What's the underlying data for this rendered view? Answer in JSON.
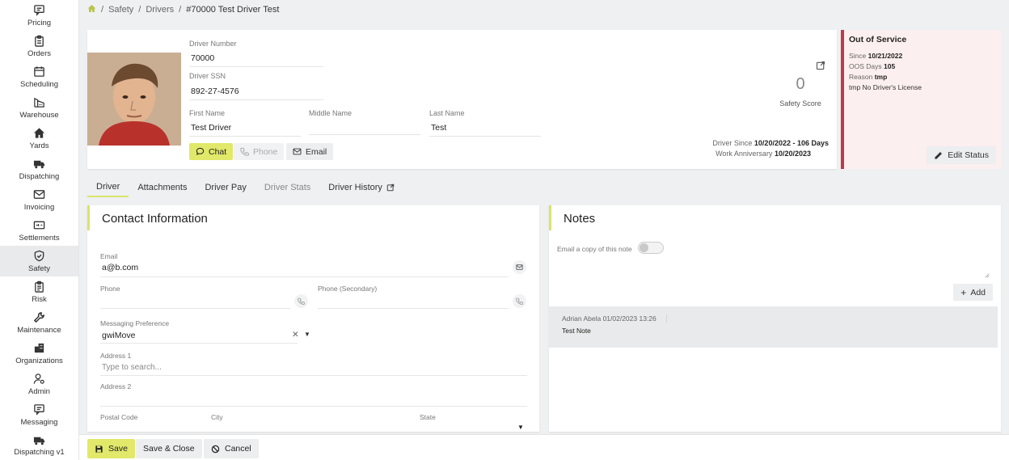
{
  "sidebar": {
    "items": [
      {
        "label": "Pricing",
        "icon": "chat-icon"
      },
      {
        "label": "Orders",
        "icon": "clipboard-icon"
      },
      {
        "label": "Scheduling",
        "icon": "calendar-icon"
      },
      {
        "label": "Warehouse",
        "icon": "warehouse-icon"
      },
      {
        "label": "Yards",
        "icon": "home-icon"
      },
      {
        "label": "Dispatching",
        "icon": "truck-icon"
      },
      {
        "label": "Invoicing",
        "icon": "envelope-icon"
      },
      {
        "label": "Settlements",
        "icon": "money-icon"
      },
      {
        "label": "Safety",
        "icon": "shield-icon",
        "active": true
      },
      {
        "label": "Risk",
        "icon": "clipboard-list-icon"
      },
      {
        "label": "Maintenance",
        "icon": "wrench-icon"
      },
      {
        "label": "Organizations",
        "icon": "buildings-icon"
      },
      {
        "label": "Admin",
        "icon": "user-gear-icon"
      },
      {
        "label": "Messaging",
        "icon": "message-icon"
      },
      {
        "label": "Dispatching v1",
        "icon": "truck-icon"
      }
    ]
  },
  "breadcrumb": {
    "items": [
      "Safety",
      "Drivers"
    ],
    "current": "#70000 Test Driver Test"
  },
  "driver": {
    "number_label": "Driver Number",
    "number": "70000",
    "ssn_label": "Driver SSN",
    "ssn": "892-27-4576",
    "first_name_label": "First Name",
    "first_name": "Test Driver",
    "middle_name_label": "Middle Name",
    "middle_name": "",
    "last_name_label": "Last Name",
    "last_name": "Test",
    "chat_label": "Chat",
    "phone_label": "Phone",
    "email_label": "Email",
    "safety_score": "0",
    "safety_score_label": "Safety Score",
    "since_label": "Driver Since",
    "since_value": "10/20/2022 - 106 Days",
    "anniversary_label": "Work Anniversary",
    "anniversary_value": "10/20/2023"
  },
  "out_of_service": {
    "title": "Out of Service",
    "since_label": "Since",
    "since": "10/21/2022",
    "days_label": "OOS Days",
    "days": "105",
    "reason_label": "Reason",
    "reason": "tmp",
    "detail": "tmp No Driver's License",
    "edit_label": "Edit Status",
    "accent_color": "#c0394b"
  },
  "tabs": [
    {
      "label": "Driver",
      "active": true
    },
    {
      "label": "Attachments"
    },
    {
      "label": "Driver Pay"
    },
    {
      "label": "Driver Stats",
      "muted": true
    },
    {
      "label": "Driver History"
    }
  ],
  "contact": {
    "title": "Contact Information",
    "email_label": "Email",
    "email": "a@b.com",
    "phone_label": "Phone",
    "phone_secondary_label": "Phone (Secondary)",
    "messaging_label": "Messaging Preference",
    "messaging_value": "gwiMove",
    "address1_label": "Address 1",
    "address1_placeholder": "Type to search...",
    "address2_label": "Address 2",
    "postal_label": "Postal Code",
    "city_label": "City",
    "state_label": "State"
  },
  "notes": {
    "title": "Notes",
    "email_copy_label": "Email a copy of this note",
    "add_label": "Add",
    "entry_meta": "Adrian Abela 01/02/2023 13:26",
    "entry_text": "Test Note"
  },
  "footer": {
    "save_label": "Save",
    "save_close_label": "Save & Close",
    "cancel_label": "Cancel"
  },
  "colors": {
    "accent": "#e1e86a",
    "oos_background": "#fcefef"
  }
}
